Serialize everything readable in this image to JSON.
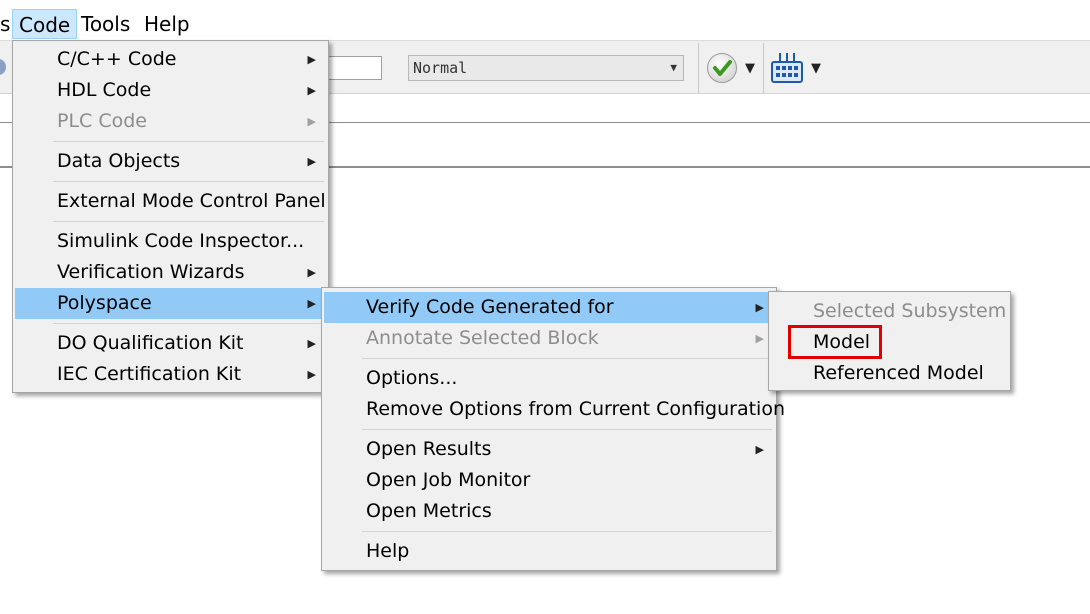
{
  "menubar": {
    "partial_item": "s",
    "code": "Code",
    "tools": "Tools",
    "help": "Help"
  },
  "toolbar": {
    "sim_mode": "Normal",
    "icons": [
      "disk-icon",
      "check-icon",
      "grid-icon"
    ]
  },
  "code_menu": {
    "items": [
      {
        "label": "C/C++ Code"
      },
      {
        "label": "HDL Code"
      },
      {
        "label": "PLC Code"
      },
      {
        "label": "Data Objects"
      },
      {
        "label": "External Mode Control Panel"
      },
      {
        "label": "Simulink Code Inspector..."
      },
      {
        "label": "Verification Wizards"
      },
      {
        "label": "Polyspace"
      },
      {
        "label": "DO Qualification Kit"
      },
      {
        "label": "IEC Certification Kit"
      }
    ]
  },
  "polyspace_menu": {
    "items": [
      {
        "label": "Verify Code Generated for"
      },
      {
        "label": "Annotate Selected Block"
      },
      {
        "label": "Options..."
      },
      {
        "label": "Remove Options from Current Configuration"
      },
      {
        "label": "Open Results"
      },
      {
        "label": "Open Job Monitor"
      },
      {
        "label": "Open Metrics"
      },
      {
        "label": "Help"
      }
    ]
  },
  "verify_menu": {
    "items": [
      {
        "label": "Selected Subsystem"
      },
      {
        "label": "Model"
      },
      {
        "label": "Referenced Model"
      }
    ]
  },
  "colors": {
    "selection": "#91c9f7",
    "highlight_box": "#e00000",
    "menu_bg": "#f0f0f0"
  }
}
